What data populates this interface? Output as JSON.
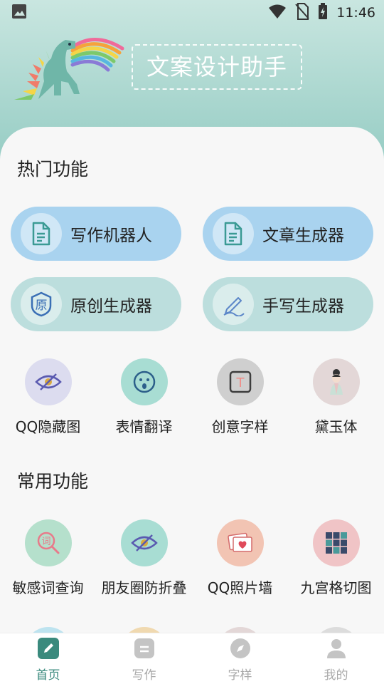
{
  "status_bar": {
    "time": "11:46"
  },
  "banner": {
    "title": "文案设计助手"
  },
  "hot_section": {
    "title": "热门功能",
    "pills": [
      {
        "label": "写作机器人",
        "icon": "document-icon"
      },
      {
        "label": "文章生成器",
        "icon": "document-icon"
      },
      {
        "label": "原创生成器",
        "icon": "original-seal-icon",
        "icon_text": "原"
      },
      {
        "label": "手写生成器",
        "icon": "pen-icon"
      }
    ],
    "grid": [
      {
        "label": "QQ隐藏图",
        "icon": "eye-hidden-icon"
      },
      {
        "label": "表情翻译",
        "icon": "emoji-face-icon"
      },
      {
        "label": "创意字样",
        "icon": "text-frame-icon",
        "icon_text": "T"
      },
      {
        "label": "黛玉体",
        "icon": "lady-portrait-icon"
      }
    ]
  },
  "common_section": {
    "title": "常用功能",
    "grid": [
      {
        "label": "敏感词查询",
        "icon": "word-search-icon",
        "icon_text": "词"
      },
      {
        "label": "朋友圈防折叠",
        "icon": "eye-hidden-icon"
      },
      {
        "label": "QQ照片墙",
        "icon": "photo-wall-icon"
      },
      {
        "label": "九宫格切图",
        "icon": "nine-grid-icon"
      }
    ]
  },
  "bottom_nav": [
    {
      "label": "首页",
      "icon": "home-pen-icon",
      "active": true
    },
    {
      "label": "写作",
      "icon": "writing-icon",
      "active": false
    },
    {
      "label": "字样",
      "icon": "compass-icon",
      "active": false
    },
    {
      "label": "我的",
      "icon": "profile-icon",
      "active": false
    }
  ],
  "colors": {
    "header_top": "#c9e6e0",
    "header_bottom": "#8fc9c0",
    "pill_blue": "#a9d3ef",
    "pill_teal": "#bcdedd",
    "nav_active": "#3a8a7d",
    "nav_inactive": "#aaaaaa"
  }
}
